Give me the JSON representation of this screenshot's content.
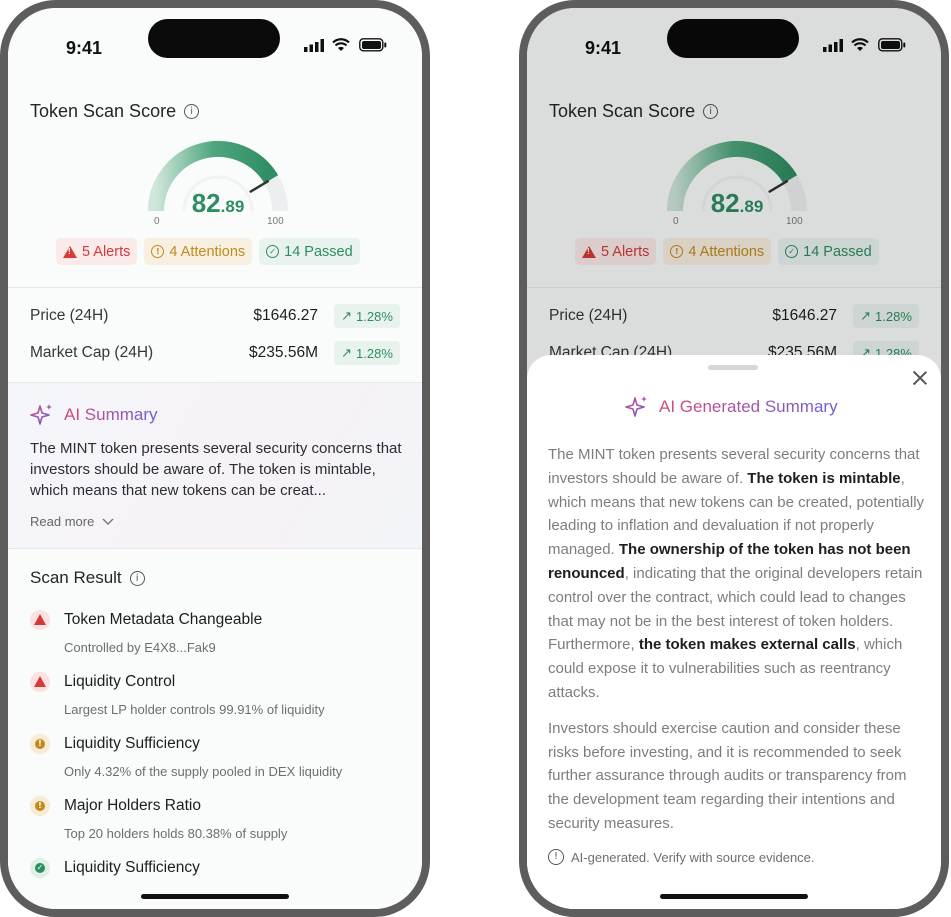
{
  "status": {
    "time": "9:41"
  },
  "score": {
    "title": "Token Scan Score",
    "integer": "82",
    "decimal": ".89",
    "value": 82.89,
    "min": "0",
    "max": "100",
    "colors": {
      "accent": "#2f8d63",
      "track": "#e9ebec"
    }
  },
  "chips": {
    "alerts": "5 Alerts",
    "attentions": "4 Attentions",
    "passed": "14 Passed"
  },
  "market": {
    "price_label": "Price (24H)",
    "price_value": "$1646.27",
    "price_change": "1.28%",
    "cap_label": "Market Cap (24H)",
    "cap_value": "$235.56M",
    "cap_change": "1.28%"
  },
  "ai_summary": {
    "title": "AI Summary",
    "preview": "The MINT token presents several security concerns that investors should be aware of. The token is mintable, which means that new tokens can be creat...",
    "read_more": "Read more"
  },
  "scan": {
    "title": "Scan Result",
    "items": [
      {
        "name": "Token Metadata Changeable",
        "desc": "Controlled by E4X8...Fak9",
        "level": "alert"
      },
      {
        "name": "Liquidity Control",
        "desc": "Largest LP holder controls 99.91% of liquidity",
        "level": "alert"
      },
      {
        "name": "Liquidity Sufficiency",
        "desc": "Only 4.32% of the supply pooled in DEX liquidity",
        "level": "attention"
      },
      {
        "name": "Major Holders Ratio",
        "desc": "Top 20 holders holds 80.38% of supply",
        "level": "attention"
      },
      {
        "name": "Liquidity Sufficiency",
        "desc": "",
        "level": "passed"
      }
    ]
  },
  "sheet": {
    "title": "AI Generated Summary",
    "p1_a": "The MINT token presents several security concerns that investors should be aware of. ",
    "p1_b": "The token is mintable",
    "p1_c": ", which means that new tokens can be created, potentially leading to inflation and devaluation if not properly managed. ",
    "p1_d": "The ownership of the token has not been renounced",
    "p1_e": ", indicating that the original developers retain control over the contract, which could lead to changes that may not be in the best interest of token holders. Furthermore, ",
    "p1_f": "the token makes external calls",
    "p1_g": ", which could expose it to vulnerabilities such as reentrancy attacks.",
    "p2": "Investors should exercise caution and consider these risks before investing, and it is recommended to seek further assurance through audits or transparency from the development team regarding their intentions and security measures.",
    "disclaimer": "AI-generated. Verify with source evidence."
  },
  "icons": [
    "info-icon",
    "alert-triangle-icon",
    "attention-icon",
    "check-circle-icon",
    "trend-up-icon",
    "sparkle-icon",
    "chevron-down-icon",
    "close-icon",
    "signal-icon",
    "wifi-icon",
    "battery-icon"
  ]
}
